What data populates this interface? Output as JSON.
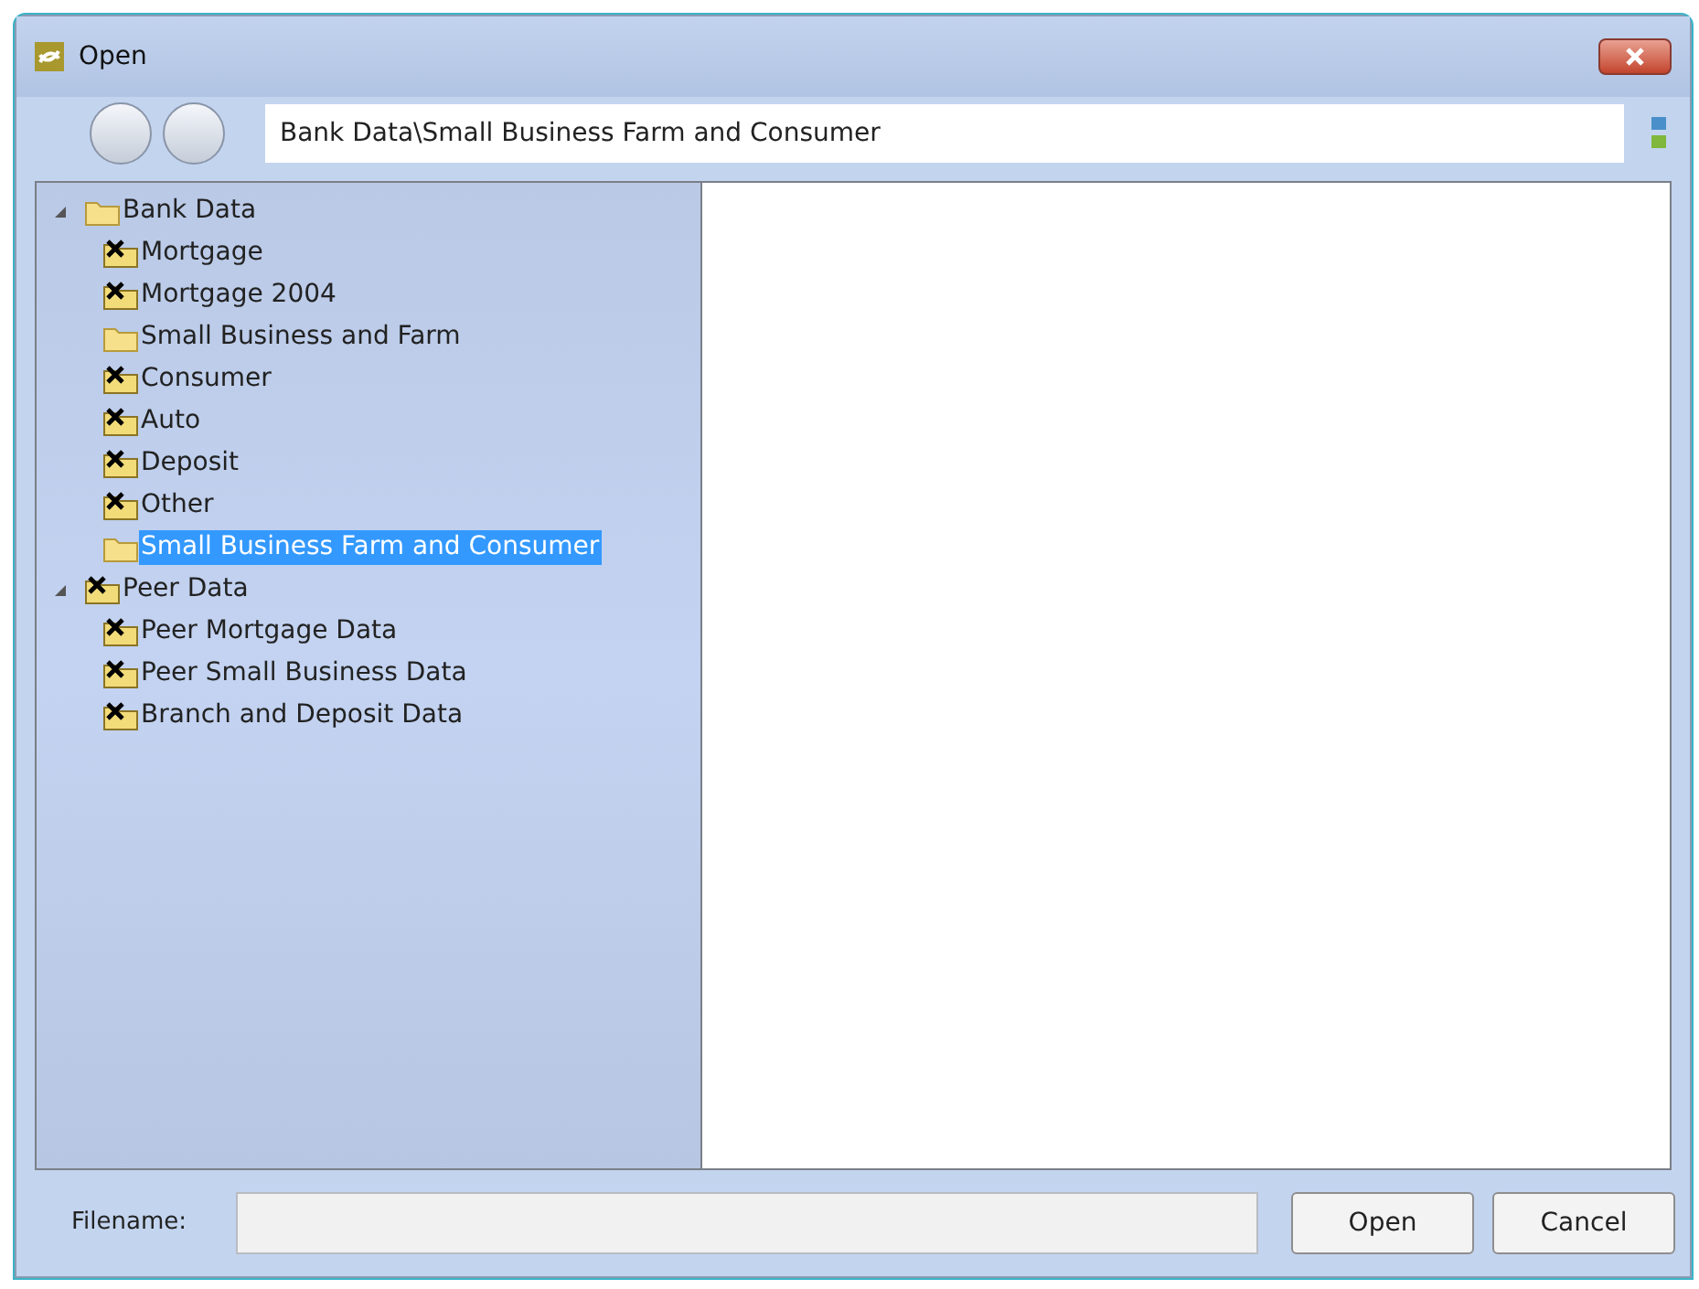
{
  "window": {
    "title": "Open"
  },
  "path": {
    "value": "Bank Data\\Small Business Farm and Consumer"
  },
  "tree": [
    {
      "label": "Bank Data",
      "kind": "folder",
      "expanded": true,
      "selected": false,
      "children": [
        {
          "label": "Mortgage",
          "kind": "sheet",
          "selected": false
        },
        {
          "label": "Mortgage 2004",
          "kind": "sheet",
          "selected": false
        },
        {
          "label": "Small Business and Farm",
          "kind": "folder",
          "selected": false
        },
        {
          "label": "Consumer",
          "kind": "sheet",
          "selected": false
        },
        {
          "label": "Auto",
          "kind": "sheet",
          "selected": false
        },
        {
          "label": "Deposit",
          "kind": "sheet",
          "selected": false
        },
        {
          "label": "Other",
          "kind": "sheet",
          "selected": false
        },
        {
          "label": "Small Business Farm and Consumer",
          "kind": "folder",
          "selected": true
        }
      ]
    },
    {
      "label": "Peer Data",
      "kind": "sheet",
      "expanded": true,
      "selected": false,
      "children": [
        {
          "label": "Peer Mortgage Data",
          "kind": "sheet",
          "selected": false
        },
        {
          "label": "Peer Small Business Data",
          "kind": "sheet",
          "selected": false
        },
        {
          "label": "Branch and Deposit Data",
          "kind": "sheet",
          "selected": false
        }
      ]
    }
  ],
  "filename": {
    "label": "Filename:"
  },
  "buttons": [
    "Open",
    "Cancel"
  ]
}
